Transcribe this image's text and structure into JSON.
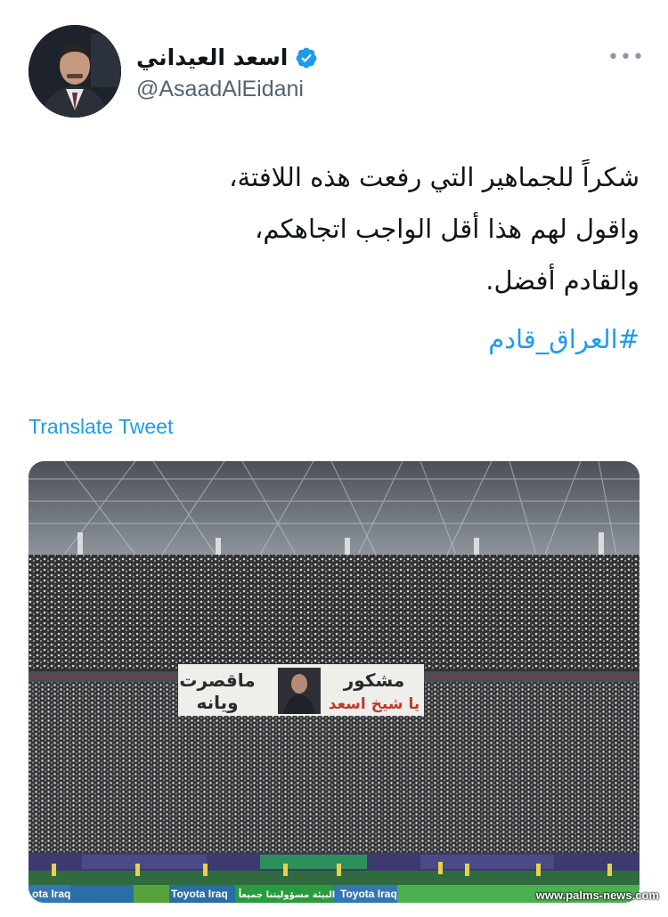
{
  "header": {
    "display_name": "اسعد العيداني",
    "handle": "@AsaadAlEidani",
    "more_label": "•••"
  },
  "tweet": {
    "lines": [
      "شكراً للجماهير التي رفعت هذه اللافتة،",
      "واقول لهم هذا أقل الواجب اتجاهكم،",
      "والقادم أفضل."
    ],
    "hashtag": "#العراق_قادم"
  },
  "translate_label": "Translate Tweet",
  "photo": {
    "banner": {
      "left_top": "ماقصرت",
      "left_bottom": "ويانه",
      "right_top": "مشكور",
      "right_bottom": "يا شيخ اسعد"
    },
    "ads": [
      "البيئة مسؤوليتنا جميعاً",
      "Toyota Iraq",
      "Toyota Iraq",
      "ota Iraq"
    ]
  },
  "watermark": "www.palms-news.com",
  "colors": {
    "accent": "#1d9bf0",
    "text": "#0f1419",
    "secondary": "#536471"
  },
  "icons": {
    "verified": "verified-badge-icon",
    "more": "more-dots-icon"
  }
}
